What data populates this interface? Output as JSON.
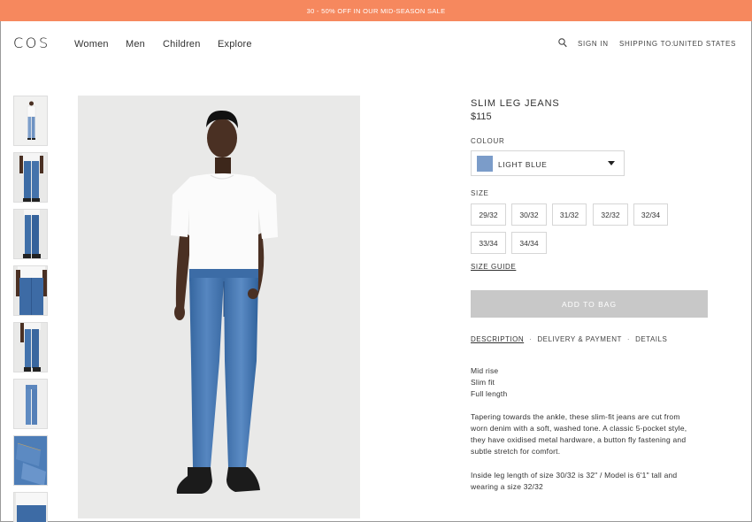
{
  "banner": {
    "text": "30 - 50% OFF IN OUR MID-SEASON SALE"
  },
  "brand": {
    "logo": "COS"
  },
  "nav": {
    "links": [
      "Women",
      "Men",
      "Children",
      "Explore"
    ],
    "search_icon": "search-icon",
    "sign_in": "SIGN IN",
    "shipping_label": "SHIPPING TO:",
    "shipping_country": "UNITED STATES"
  },
  "gallery": {
    "thumbnails": [
      "model-front-full",
      "jeans-front-legs",
      "jeans-side-legs",
      "jeans-back-pocket",
      "jeans-side-walk",
      "jeans-flat-lay",
      "jeans-fabric-detail",
      "jeans-waist-detail"
    ]
  },
  "product": {
    "title": "SLIM LEG JEANS",
    "price": "$115",
    "colour_label": "COLOUR",
    "colour_value": "LIGHT BLUE",
    "colour_swatch": "#7b9cc9",
    "size_label": "SIZE",
    "sizes": [
      "29/32",
      "30/32",
      "31/32",
      "32/32",
      "32/34",
      "33/34",
      "34/34"
    ],
    "size_guide": "SIZE GUIDE",
    "add_to_bag": "ADD TO BAG"
  },
  "tabs": [
    "DESCRIPTION",
    "DELIVERY & PAYMENT",
    "DETAILS"
  ],
  "description": {
    "features": [
      "Mid rise",
      "Slim fit",
      "Full length"
    ],
    "paragraph1": [
      "Tapering towards the ankle, these slim-fit jeans are cut from",
      "worn denim with a soft, washed tone. A classic 5-pocket style,",
      "they have oxidised metal hardware, a button fly fastening and",
      "subtle stretch for comfort."
    ],
    "paragraph2": [
      "Inside leg length of size 30/32 is 32\" / Model is 6'1\" tall and",
      "wearing a size 32/32"
    ]
  },
  "colors": {
    "banner": "#f6885e",
    "button_disabled": "#c8c8c8"
  }
}
